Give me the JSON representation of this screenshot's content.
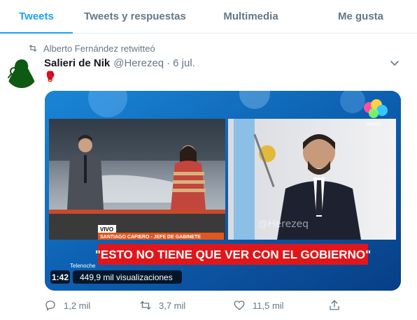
{
  "tabs": [
    {
      "label": "Tweets",
      "active": true
    },
    {
      "label": "Tweets y respuestas",
      "active": false
    },
    {
      "label": "Multimedia",
      "active": false
    },
    {
      "label": "Me gusta",
      "active": false
    }
  ],
  "retweet_context": "Alberto Fernández retwitteó",
  "tweet": {
    "display_name": "Salieri de Nik",
    "handle": "@Herezeq",
    "separator": "·",
    "date": "6 jul.",
    "text": "🥊"
  },
  "video": {
    "watermark": "@Herezeq",
    "live_badge": "VIVO",
    "lower_third": "SANTIAGO CAFIERO - JEFE DE GABINETE",
    "headline": "\"ESTO NO TIENE QUE VER CON EL GOBIERNO\"",
    "program": "Telenoche",
    "channel": "eltrece",
    "duration": "1:42",
    "views": "449,9 mil visualizaciones"
  },
  "actions": {
    "replies": "1,2 mil",
    "retweets": "3,7 mil",
    "likes": "11,5 mil"
  },
  "colors": {
    "accent": "#1da1f2",
    "secondary_text": "#657786"
  },
  "icons": [
    "retweet-icon",
    "chevron-down-icon",
    "reply-icon",
    "like-icon",
    "share-icon"
  ]
}
